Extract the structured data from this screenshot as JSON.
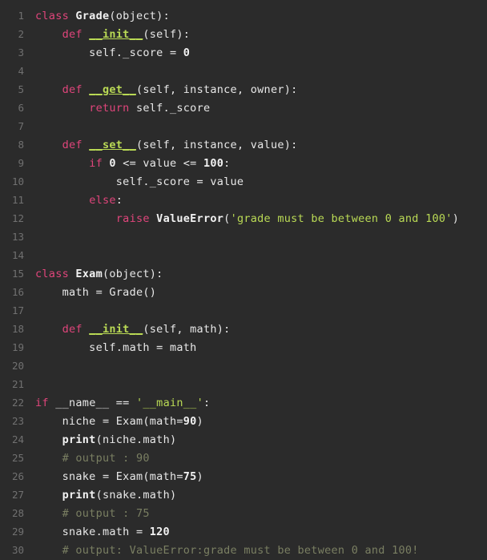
{
  "editor": {
    "background_color": "#2b2b2b",
    "gutter_color": "#707070",
    "language": "python",
    "total_lines": 30
  },
  "colors": {
    "keyword": "#e0457b",
    "string": "#bada55",
    "magic_method": "#bada55",
    "comment": "#7a7f62",
    "identifier": "#f2f2f2",
    "plain_text": "#e8e8e8",
    "line_number": "#707070",
    "background": "#2b2b2b"
  },
  "lines": [
    {
      "n": "1",
      "tokens": [
        {
          "t": "class ",
          "c": "kw"
        },
        {
          "t": "Grade",
          "c": "name"
        },
        {
          "t": "(object):",
          "c": "plain"
        }
      ]
    },
    {
      "n": "2",
      "tokens": [
        {
          "t": "    ",
          "c": "plain"
        },
        {
          "t": "def ",
          "c": "kw"
        },
        {
          "t": "__init__",
          "c": "magic"
        },
        {
          "t": "(self):",
          "c": "plain"
        }
      ]
    },
    {
      "n": "3",
      "tokens": [
        {
          "t": "        self._score = ",
          "c": "plain"
        },
        {
          "t": "0",
          "c": "num"
        }
      ]
    },
    {
      "n": "4",
      "tokens": [
        {
          "t": "",
          "c": "plain"
        }
      ]
    },
    {
      "n": "5",
      "tokens": [
        {
          "t": "    ",
          "c": "plain"
        },
        {
          "t": "def ",
          "c": "kw"
        },
        {
          "t": "__get__",
          "c": "magic"
        },
        {
          "t": "(self, instance, owner):",
          "c": "plain"
        }
      ]
    },
    {
      "n": "6",
      "tokens": [
        {
          "t": "        ",
          "c": "plain"
        },
        {
          "t": "return ",
          "c": "kw"
        },
        {
          "t": "self._score",
          "c": "plain"
        }
      ]
    },
    {
      "n": "7",
      "tokens": [
        {
          "t": "",
          "c": "plain"
        }
      ]
    },
    {
      "n": "8",
      "tokens": [
        {
          "t": "    ",
          "c": "plain"
        },
        {
          "t": "def ",
          "c": "kw"
        },
        {
          "t": "__set__",
          "c": "magic"
        },
        {
          "t": "(self, instance, value):",
          "c": "plain"
        }
      ]
    },
    {
      "n": "9",
      "tokens": [
        {
          "t": "        ",
          "c": "plain"
        },
        {
          "t": "if ",
          "c": "kw"
        },
        {
          "t": "0",
          "c": "num"
        },
        {
          "t": " <= value <= ",
          "c": "plain"
        },
        {
          "t": "100",
          "c": "num"
        },
        {
          "t": ":",
          "c": "plain"
        }
      ]
    },
    {
      "n": "10",
      "tokens": [
        {
          "t": "            self._score = value",
          "c": "plain"
        }
      ]
    },
    {
      "n": "11",
      "tokens": [
        {
          "t": "        ",
          "c": "plain"
        },
        {
          "t": "else",
          "c": "kw"
        },
        {
          "t": ":",
          "c": "plain"
        }
      ]
    },
    {
      "n": "12",
      "tokens": [
        {
          "t": "            ",
          "c": "plain"
        },
        {
          "t": "raise ",
          "c": "kw"
        },
        {
          "t": "ValueError",
          "c": "builtin"
        },
        {
          "t": "(",
          "c": "plain"
        },
        {
          "t": "'grade must be between 0 and 100'",
          "c": "str"
        },
        {
          "t": ")",
          "c": "plain"
        }
      ]
    },
    {
      "n": "13",
      "tokens": [
        {
          "t": "",
          "c": "plain"
        }
      ]
    },
    {
      "n": "14",
      "tokens": [
        {
          "t": "",
          "c": "plain"
        }
      ]
    },
    {
      "n": "15",
      "tokens": [
        {
          "t": "class ",
          "c": "kw"
        },
        {
          "t": "Exam",
          "c": "name"
        },
        {
          "t": "(object):",
          "c": "plain"
        }
      ]
    },
    {
      "n": "16",
      "tokens": [
        {
          "t": "    math = Grade()",
          "c": "plain"
        }
      ]
    },
    {
      "n": "17",
      "tokens": [
        {
          "t": "",
          "c": "plain"
        }
      ]
    },
    {
      "n": "18",
      "tokens": [
        {
          "t": "    ",
          "c": "plain"
        },
        {
          "t": "def ",
          "c": "kw"
        },
        {
          "t": "__init__",
          "c": "magic"
        },
        {
          "t": "(self, math):",
          "c": "plain"
        }
      ]
    },
    {
      "n": "19",
      "tokens": [
        {
          "t": "        self.math = math",
          "c": "plain"
        }
      ]
    },
    {
      "n": "20",
      "tokens": [
        {
          "t": "",
          "c": "plain"
        }
      ]
    },
    {
      "n": "21",
      "tokens": [
        {
          "t": "",
          "c": "plain"
        }
      ]
    },
    {
      "n": "22",
      "tokens": [
        {
          "t": "if ",
          "c": "kw"
        },
        {
          "t": "__name__ == ",
          "c": "plain"
        },
        {
          "t": "'__main__'",
          "c": "str"
        },
        {
          "t": ":",
          "c": "plain"
        }
      ]
    },
    {
      "n": "23",
      "tokens": [
        {
          "t": "    niche = Exam(math=",
          "c": "plain"
        },
        {
          "t": "90",
          "c": "num"
        },
        {
          "t": ")",
          "c": "plain"
        }
      ]
    },
    {
      "n": "24",
      "tokens": [
        {
          "t": "    ",
          "c": "plain"
        },
        {
          "t": "print",
          "c": "builtin"
        },
        {
          "t": "(niche.math)",
          "c": "plain"
        }
      ]
    },
    {
      "n": "25",
      "tokens": [
        {
          "t": "    ",
          "c": "plain"
        },
        {
          "t": "# output : 90",
          "c": "comment"
        }
      ]
    },
    {
      "n": "26",
      "tokens": [
        {
          "t": "    snake = Exam(math=",
          "c": "plain"
        },
        {
          "t": "75",
          "c": "num"
        },
        {
          "t": ")",
          "c": "plain"
        }
      ]
    },
    {
      "n": "27",
      "tokens": [
        {
          "t": "    ",
          "c": "plain"
        },
        {
          "t": "print",
          "c": "builtin"
        },
        {
          "t": "(snake.math)",
          "c": "plain"
        }
      ]
    },
    {
      "n": "28",
      "tokens": [
        {
          "t": "    ",
          "c": "plain"
        },
        {
          "t": "# output : 75",
          "c": "comment"
        }
      ]
    },
    {
      "n": "29",
      "tokens": [
        {
          "t": "    snake.math = ",
          "c": "plain"
        },
        {
          "t": "120",
          "c": "num"
        }
      ]
    },
    {
      "n": "30",
      "tokens": [
        {
          "t": "    ",
          "c": "plain"
        },
        {
          "t": "# output: ValueError:grade must be between 0 and 100!",
          "c": "comment"
        }
      ]
    }
  ]
}
